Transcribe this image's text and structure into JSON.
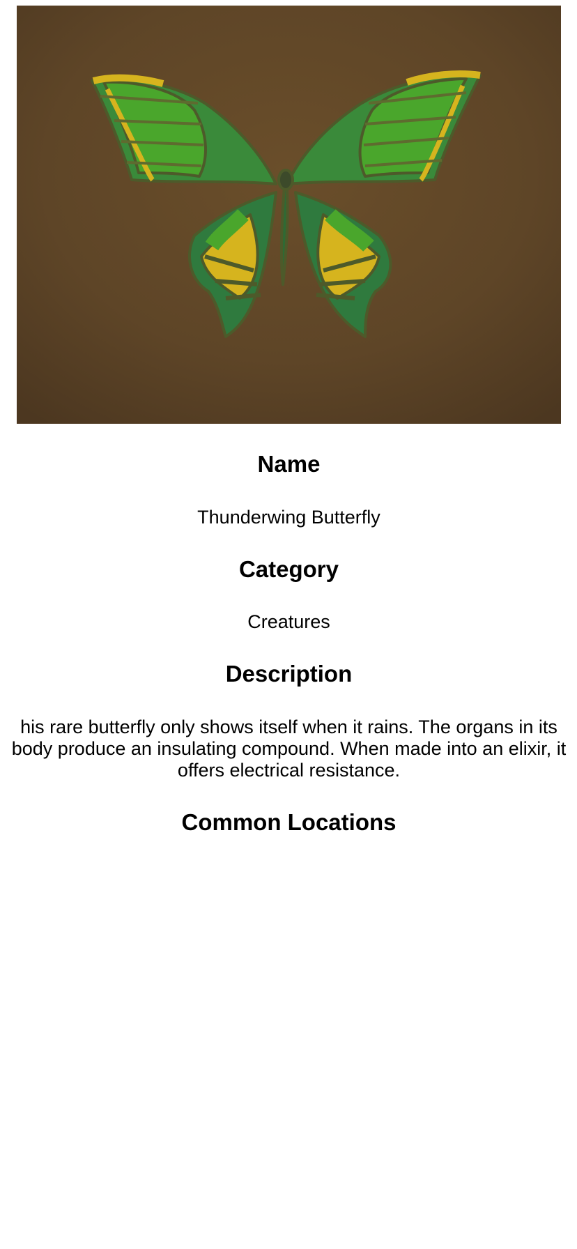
{
  "item": {
    "image_alt": "Thunderwing Butterfly",
    "labels": {
      "name": "Name",
      "category": "Category",
      "description": "Description",
      "common_locations": "Common Locations"
    },
    "name": "Thunderwing Butterfly",
    "category": "Creatures",
    "description": "his rare butterfly only shows itself when it rains. The organs in its body produce an insulating compound. When made into an elixir, it offers electrical resistance."
  },
  "colors": {
    "background": "#ffffff",
    "text": "#000000",
    "image_backdrop": "#5a4226",
    "wing_green": "#4aa62c",
    "wing_dark": "#2f7a3e",
    "wing_yellow": "#d6b41e"
  }
}
